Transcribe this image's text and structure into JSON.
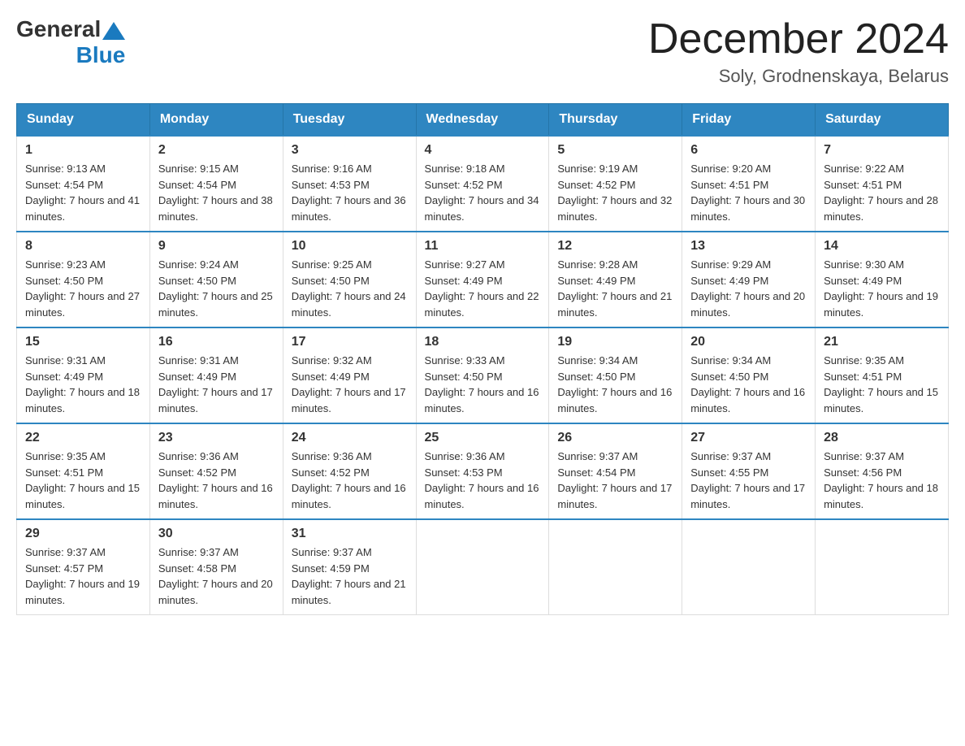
{
  "header": {
    "logo": {
      "general": "General",
      "blue": "Blue"
    },
    "month_title": "December 2024",
    "location": "Soly, Grodnenskaya, Belarus"
  },
  "days_of_week": [
    "Sunday",
    "Monday",
    "Tuesday",
    "Wednesday",
    "Thursday",
    "Friday",
    "Saturday"
  ],
  "weeks": [
    [
      {
        "day": "1",
        "sunrise": "Sunrise: 9:13 AM",
        "sunset": "Sunset: 4:54 PM",
        "daylight": "Daylight: 7 hours and 41 minutes."
      },
      {
        "day": "2",
        "sunrise": "Sunrise: 9:15 AM",
        "sunset": "Sunset: 4:54 PM",
        "daylight": "Daylight: 7 hours and 38 minutes."
      },
      {
        "day": "3",
        "sunrise": "Sunrise: 9:16 AM",
        "sunset": "Sunset: 4:53 PM",
        "daylight": "Daylight: 7 hours and 36 minutes."
      },
      {
        "day": "4",
        "sunrise": "Sunrise: 9:18 AM",
        "sunset": "Sunset: 4:52 PM",
        "daylight": "Daylight: 7 hours and 34 minutes."
      },
      {
        "day": "5",
        "sunrise": "Sunrise: 9:19 AM",
        "sunset": "Sunset: 4:52 PM",
        "daylight": "Daylight: 7 hours and 32 minutes."
      },
      {
        "day": "6",
        "sunrise": "Sunrise: 9:20 AM",
        "sunset": "Sunset: 4:51 PM",
        "daylight": "Daylight: 7 hours and 30 minutes."
      },
      {
        "day": "7",
        "sunrise": "Sunrise: 9:22 AM",
        "sunset": "Sunset: 4:51 PM",
        "daylight": "Daylight: 7 hours and 28 minutes."
      }
    ],
    [
      {
        "day": "8",
        "sunrise": "Sunrise: 9:23 AM",
        "sunset": "Sunset: 4:50 PM",
        "daylight": "Daylight: 7 hours and 27 minutes."
      },
      {
        "day": "9",
        "sunrise": "Sunrise: 9:24 AM",
        "sunset": "Sunset: 4:50 PM",
        "daylight": "Daylight: 7 hours and 25 minutes."
      },
      {
        "day": "10",
        "sunrise": "Sunrise: 9:25 AM",
        "sunset": "Sunset: 4:50 PM",
        "daylight": "Daylight: 7 hours and 24 minutes."
      },
      {
        "day": "11",
        "sunrise": "Sunrise: 9:27 AM",
        "sunset": "Sunset: 4:49 PM",
        "daylight": "Daylight: 7 hours and 22 minutes."
      },
      {
        "day": "12",
        "sunrise": "Sunrise: 9:28 AM",
        "sunset": "Sunset: 4:49 PM",
        "daylight": "Daylight: 7 hours and 21 minutes."
      },
      {
        "day": "13",
        "sunrise": "Sunrise: 9:29 AM",
        "sunset": "Sunset: 4:49 PM",
        "daylight": "Daylight: 7 hours and 20 minutes."
      },
      {
        "day": "14",
        "sunrise": "Sunrise: 9:30 AM",
        "sunset": "Sunset: 4:49 PM",
        "daylight": "Daylight: 7 hours and 19 minutes."
      }
    ],
    [
      {
        "day": "15",
        "sunrise": "Sunrise: 9:31 AM",
        "sunset": "Sunset: 4:49 PM",
        "daylight": "Daylight: 7 hours and 18 minutes."
      },
      {
        "day": "16",
        "sunrise": "Sunrise: 9:31 AM",
        "sunset": "Sunset: 4:49 PM",
        "daylight": "Daylight: 7 hours and 17 minutes."
      },
      {
        "day": "17",
        "sunrise": "Sunrise: 9:32 AM",
        "sunset": "Sunset: 4:49 PM",
        "daylight": "Daylight: 7 hours and 17 minutes."
      },
      {
        "day": "18",
        "sunrise": "Sunrise: 9:33 AM",
        "sunset": "Sunset: 4:50 PM",
        "daylight": "Daylight: 7 hours and 16 minutes."
      },
      {
        "day": "19",
        "sunrise": "Sunrise: 9:34 AM",
        "sunset": "Sunset: 4:50 PM",
        "daylight": "Daylight: 7 hours and 16 minutes."
      },
      {
        "day": "20",
        "sunrise": "Sunrise: 9:34 AM",
        "sunset": "Sunset: 4:50 PM",
        "daylight": "Daylight: 7 hours and 16 minutes."
      },
      {
        "day": "21",
        "sunrise": "Sunrise: 9:35 AM",
        "sunset": "Sunset: 4:51 PM",
        "daylight": "Daylight: 7 hours and 15 minutes."
      }
    ],
    [
      {
        "day": "22",
        "sunrise": "Sunrise: 9:35 AM",
        "sunset": "Sunset: 4:51 PM",
        "daylight": "Daylight: 7 hours and 15 minutes."
      },
      {
        "day": "23",
        "sunrise": "Sunrise: 9:36 AM",
        "sunset": "Sunset: 4:52 PM",
        "daylight": "Daylight: 7 hours and 16 minutes."
      },
      {
        "day": "24",
        "sunrise": "Sunrise: 9:36 AM",
        "sunset": "Sunset: 4:52 PM",
        "daylight": "Daylight: 7 hours and 16 minutes."
      },
      {
        "day": "25",
        "sunrise": "Sunrise: 9:36 AM",
        "sunset": "Sunset: 4:53 PM",
        "daylight": "Daylight: 7 hours and 16 minutes."
      },
      {
        "day": "26",
        "sunrise": "Sunrise: 9:37 AM",
        "sunset": "Sunset: 4:54 PM",
        "daylight": "Daylight: 7 hours and 17 minutes."
      },
      {
        "day": "27",
        "sunrise": "Sunrise: 9:37 AM",
        "sunset": "Sunset: 4:55 PM",
        "daylight": "Daylight: 7 hours and 17 minutes."
      },
      {
        "day": "28",
        "sunrise": "Sunrise: 9:37 AM",
        "sunset": "Sunset: 4:56 PM",
        "daylight": "Daylight: 7 hours and 18 minutes."
      }
    ],
    [
      {
        "day": "29",
        "sunrise": "Sunrise: 9:37 AM",
        "sunset": "Sunset: 4:57 PM",
        "daylight": "Daylight: 7 hours and 19 minutes."
      },
      {
        "day": "30",
        "sunrise": "Sunrise: 9:37 AM",
        "sunset": "Sunset: 4:58 PM",
        "daylight": "Daylight: 7 hours and 20 minutes."
      },
      {
        "day": "31",
        "sunrise": "Sunrise: 9:37 AM",
        "sunset": "Sunset: 4:59 PM",
        "daylight": "Daylight: 7 hours and 21 minutes."
      },
      null,
      null,
      null,
      null
    ]
  ]
}
